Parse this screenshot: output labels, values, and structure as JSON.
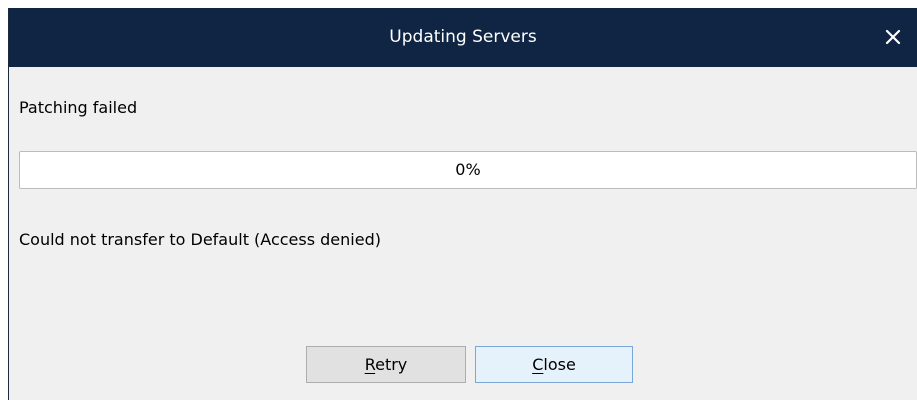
{
  "dialog": {
    "title": "Updating Servers",
    "status": "Patching failed",
    "progress": {
      "percent": 0,
      "label": "0%"
    },
    "message": "Could not transfer to Default (Access denied)",
    "buttons": {
      "retry_label": "Retry",
      "close_label": "Close"
    },
    "close_icon": "close-icon",
    "colors": {
      "titlebar": "#0f2543",
      "background": "#f0f0f0",
      "progress_fill": "#06b025"
    }
  }
}
